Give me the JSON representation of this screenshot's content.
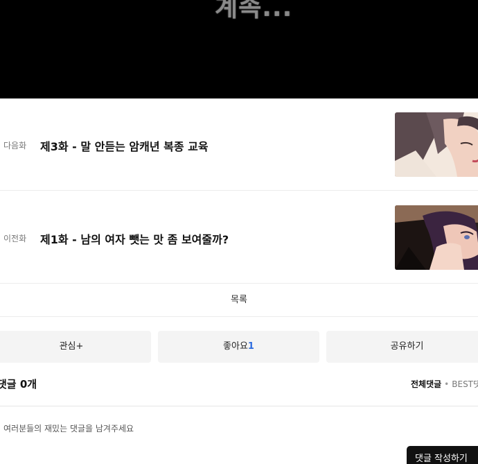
{
  "viewer": {
    "overlay_text": "계속..."
  },
  "episodes": {
    "next": {
      "kind_label": "다음화",
      "title": "제3화 - 말 안듣는 암캐년 복종 교육",
      "thumb_icon": "episode-thumbnail"
    },
    "prev": {
      "kind_label": "이전화",
      "title": "제1화 - 남의 여자 뺏는 맛 좀 보여줄까?",
      "thumb_icon": "episode-thumbnail"
    }
  },
  "list_button": {
    "label": "목록"
  },
  "actions": {
    "interest_label": "관심+",
    "like_label": "좋아요",
    "like_count": "1",
    "share_label": "공유하기"
  },
  "comments": {
    "title": "댓글 0개",
    "tab_all": "전체댓글",
    "tab_separator": "•",
    "tab_best": "BEST댓글",
    "input_placeholder": "여러분들의 재밌는 댓글을 남겨주세요",
    "input_value": "",
    "submit_label": "댓글 작성하기"
  },
  "colors": {
    "accent_like": "#2d6cdf",
    "submit_bg": "#111111",
    "button_bg": "#f4f4f4"
  }
}
